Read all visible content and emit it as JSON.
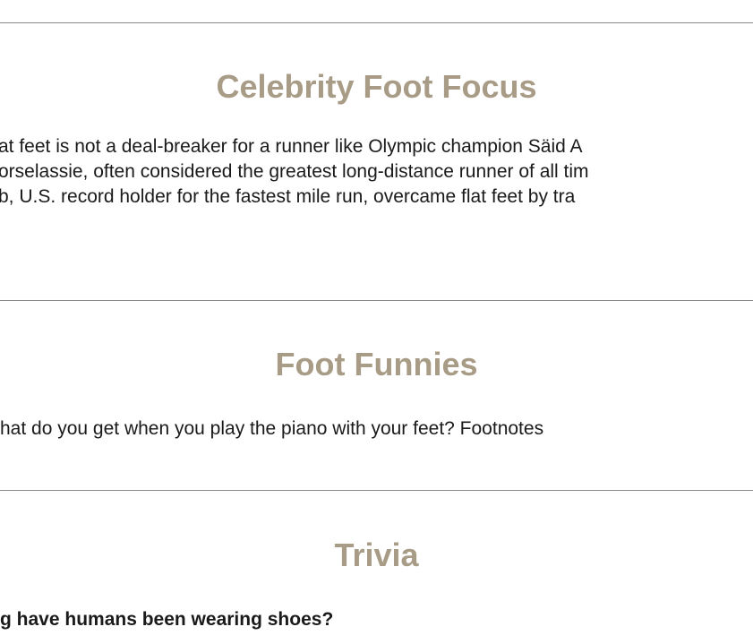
{
  "sections": {
    "celebrity": {
      "title": "Celebrity Foot Focus",
      "lines": [
        "at feet is not a deal-breaker for a runner like Olympic champion Säid A",
        "orselassie, often considered the greatest long-distance runner of all tim",
        "b, U.S. record holder for the fastest mile run, overcame flat feet by tra"
      ]
    },
    "funnies": {
      "title": "Foot Funnies",
      "text": "hat do you get when you play the piano with your feet? Footnotes"
    },
    "trivia": {
      "title": "Trivia",
      "question": "g have humans been wearing shoes?"
    }
  }
}
